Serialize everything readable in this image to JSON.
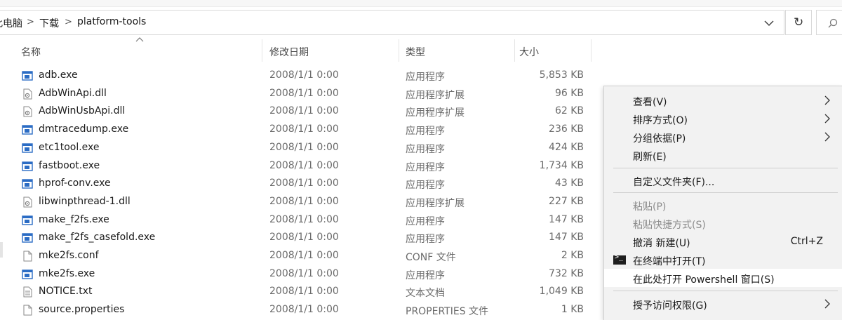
{
  "breadcrumb": [
    {
      "label": "此电脑"
    },
    {
      "label": "下载"
    },
    {
      "label": "platform-tools"
    }
  ],
  "columns": {
    "name": "名称",
    "date": "修改日期",
    "type": "类型",
    "size": "大小"
  },
  "files": [
    {
      "name": "adb.exe",
      "date": "2008/1/1 0:00",
      "type": "应用程序",
      "size": "5,853 KB",
      "icon": "exe-icon"
    },
    {
      "name": "AdbWinApi.dll",
      "date": "2008/1/1 0:00",
      "type": "应用程序扩展",
      "size": "96 KB",
      "icon": "dll-icon"
    },
    {
      "name": "AdbWinUsbApi.dll",
      "date": "2008/1/1 0:00",
      "type": "应用程序扩展",
      "size": "62 KB",
      "icon": "dll-icon"
    },
    {
      "name": "dmtracedump.exe",
      "date": "2008/1/1 0:00",
      "type": "应用程序",
      "size": "236 KB",
      "icon": "exe-icon"
    },
    {
      "name": "etc1tool.exe",
      "date": "2008/1/1 0:00",
      "type": "应用程序",
      "size": "424 KB",
      "icon": "exe-icon"
    },
    {
      "name": "fastboot.exe",
      "date": "2008/1/1 0:00",
      "type": "应用程序",
      "size": "1,734 KB",
      "icon": "exe-icon"
    },
    {
      "name": "hprof-conv.exe",
      "date": "2008/1/1 0:00",
      "type": "应用程序",
      "size": "43 KB",
      "icon": "exe-icon"
    },
    {
      "name": "libwinpthread-1.dll",
      "date": "2008/1/1 0:00",
      "type": "应用程序扩展",
      "size": "227 KB",
      "icon": "dll-icon"
    },
    {
      "name": "make_f2fs.exe",
      "date": "2008/1/1 0:00",
      "type": "应用程序",
      "size": "147 KB",
      "icon": "exe-icon"
    },
    {
      "name": "make_f2fs_casefold.exe",
      "date": "2008/1/1 0:00",
      "type": "应用程序",
      "size": "147 KB",
      "icon": "exe-icon"
    },
    {
      "name": "mke2fs.conf",
      "date": "2008/1/1 0:00",
      "type": "CONF 文件",
      "size": "2 KB",
      "icon": "file-icon"
    },
    {
      "name": "mke2fs.exe",
      "date": "2008/1/1 0:00",
      "type": "应用程序",
      "size": "732 KB",
      "icon": "exe-icon"
    },
    {
      "name": "NOTICE.txt",
      "date": "2008/1/1 0:00",
      "type": "文本文档",
      "size": "1,049 KB",
      "icon": "text-file-icon"
    },
    {
      "name": "source.properties",
      "date": "2008/1/1 0:00",
      "type": "PROPERTIES 文件",
      "size": "1 KB",
      "icon": "file-icon"
    }
  ],
  "context_menu": {
    "view": "查看(V)",
    "sort_by": "排序方式(O)",
    "group_by": "分组依据(P)",
    "refresh": "刷新(E)",
    "customize_folder": "自定义文件夹(F)...",
    "paste": "粘贴(P)",
    "paste_shortcut": "粘贴快捷方式(S)",
    "undo_new": "撤消 新建(U)",
    "undo_shortcut": "Ctrl+Z",
    "open_in_terminal": "在终端中打开(T)",
    "open_powershell": "在此处打开 Powershell 窗口(S)",
    "give_access": "授予访问权限(G)"
  },
  "colors": {
    "exe_icon": "#2b6cc4",
    "menu_bg": "#f2f2f2",
    "hover": "#ffffff"
  }
}
